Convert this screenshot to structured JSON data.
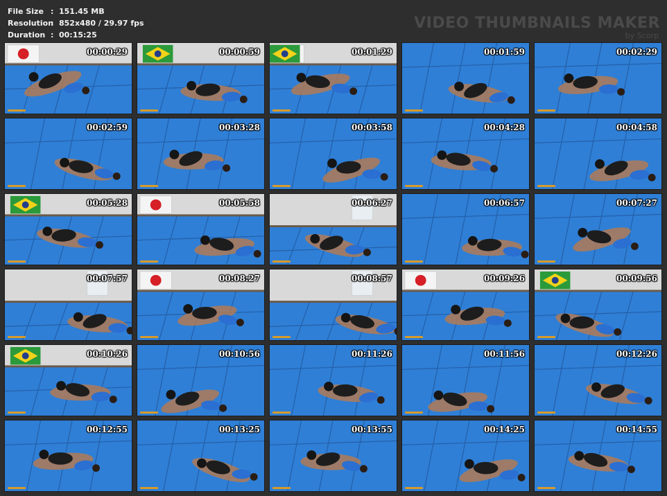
{
  "info": {
    "file_size_label": "File Size",
    "file_size_value": "151.45 MB",
    "resolution_label": "Resolution",
    "resolution_value": "852x480 / 29.97 fps",
    "duration_label": "Duration",
    "duration_value": "00:15:25",
    "separator": ":"
  },
  "watermark": {
    "title": "VIDEO THUMBNAILS MAKER",
    "subtitle": "by Scorp"
  },
  "colors": {
    "mat_blue": "#2f7fd6",
    "wall": "#d9d9d9",
    "floor_edge": "#6b5a4a",
    "skin": "#b07a55",
    "dark_clothing": "#1d1d1d",
    "blue_shirt": "#2a6fd1",
    "accent_logo": "#d89b2a"
  },
  "thumbnails": [
    {
      "time": "00:00:29",
      "scene": "flag-jp"
    },
    {
      "time": "00:00:59",
      "scene": "flag-br"
    },
    {
      "time": "00:01:29",
      "scene": "flag-both"
    },
    {
      "time": "00:01:59",
      "scene": "mat"
    },
    {
      "time": "00:02:29",
      "scene": "mat"
    },
    {
      "time": "00:02:59",
      "scene": "mat"
    },
    {
      "time": "00:03:28",
      "scene": "mat"
    },
    {
      "time": "00:03:58",
      "scene": "mat"
    },
    {
      "time": "00:04:28",
      "scene": "mat"
    },
    {
      "time": "00:04:58",
      "scene": "mat"
    },
    {
      "time": "00:05:28",
      "scene": "flag-br"
    },
    {
      "time": "00:05:58",
      "scene": "flag-jp"
    },
    {
      "time": "00:06:27",
      "scene": "wall"
    },
    {
      "time": "00:06:57",
      "scene": "mat"
    },
    {
      "time": "00:07:27",
      "scene": "mat"
    },
    {
      "time": "00:07:57",
      "scene": "wall"
    },
    {
      "time": "00:08:27",
      "scene": "flag-jp"
    },
    {
      "time": "00:08:57",
      "scene": "wall"
    },
    {
      "time": "00:09:26",
      "scene": "flag-jp"
    },
    {
      "time": "00:09:56",
      "scene": "flag-br"
    },
    {
      "time": "00:10:26",
      "scene": "flag-br"
    },
    {
      "time": "00:10:56",
      "scene": "mat"
    },
    {
      "time": "00:11:26",
      "scene": "mat"
    },
    {
      "time": "00:11:56",
      "scene": "mat"
    },
    {
      "time": "00:12:26",
      "scene": "mat"
    },
    {
      "time": "00:12:55",
      "scene": "mat"
    },
    {
      "time": "00:13:25",
      "scene": "mat"
    },
    {
      "time": "00:13:55",
      "scene": "mat"
    },
    {
      "time": "00:14:25",
      "scene": "mat"
    },
    {
      "time": "00:14:55",
      "scene": "mat"
    }
  ]
}
